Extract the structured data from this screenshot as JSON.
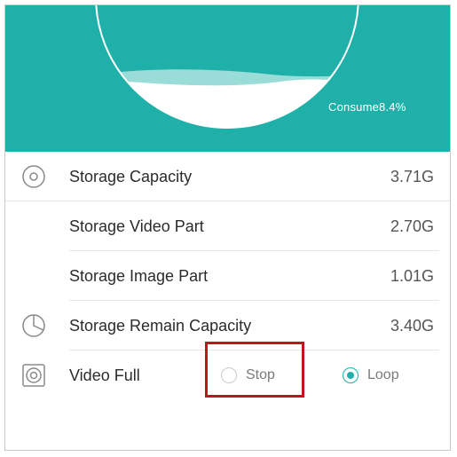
{
  "header": {
    "consume_text": "Consume8.4%",
    "consume_fraction": 0.084,
    "accent_color": "#1fb1a9"
  },
  "storage": {
    "rows": [
      {
        "icon": "disc-icon",
        "label": "Storage Capacity",
        "value": "3.71G"
      },
      {
        "icon": "",
        "label": "Storage Video Part",
        "value": "2.70G"
      },
      {
        "icon": "",
        "label": "Storage Image Part",
        "value": "1.01G"
      },
      {
        "icon": "pie-chart-icon",
        "label": "Storage Remain Capacity",
        "value": "3.40G"
      }
    ]
  },
  "video_full": {
    "icon": "record-icon",
    "label": "Video Full",
    "options": [
      {
        "label": "Stop",
        "checked": false
      },
      {
        "label": "Loop",
        "checked": true
      }
    ],
    "highlight_color": "#c0151c"
  }
}
